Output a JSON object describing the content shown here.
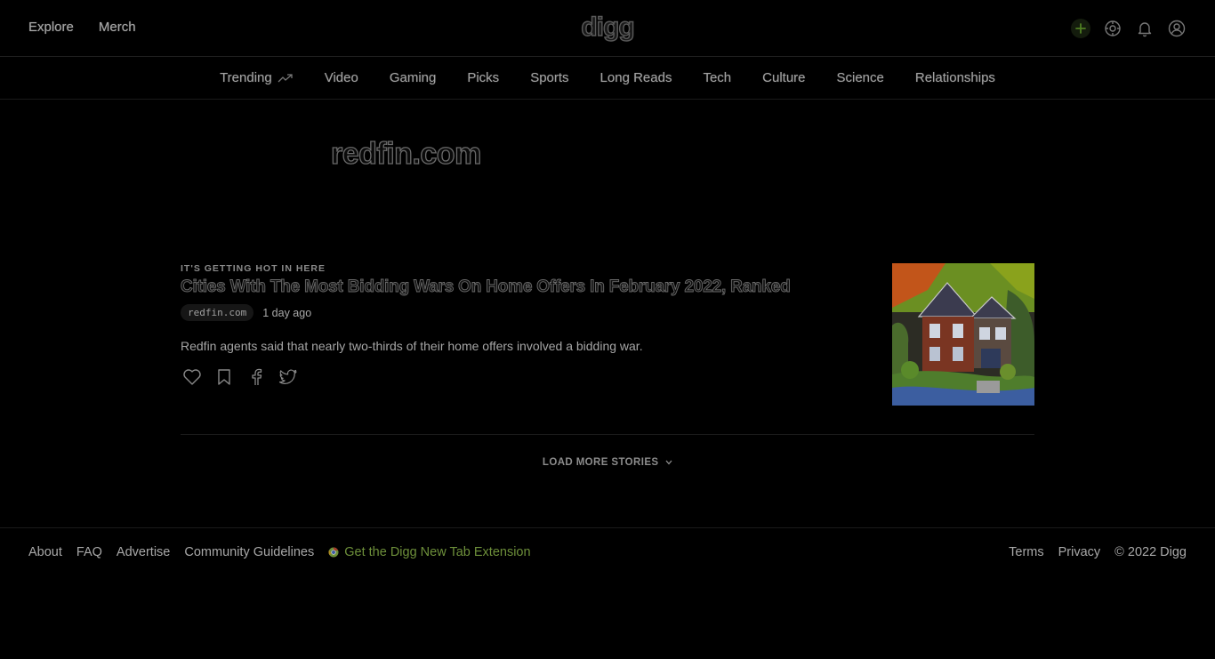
{
  "header": {
    "left_links": [
      "Explore",
      "Merch"
    ],
    "logo": "digg",
    "icons": [
      "plus-icon",
      "settings-icon",
      "bell-icon",
      "user-icon"
    ]
  },
  "nav": {
    "items": [
      "Trending",
      "Video",
      "Gaming",
      "Picks",
      "Sports",
      "Long Reads",
      "Tech",
      "Culture",
      "Science",
      "Relationships"
    ]
  },
  "page": {
    "title": "redfin.com"
  },
  "story": {
    "kicker": "IT'S GETTING HOT IN HERE",
    "title": "Cities With The Most Bidding Wars On Home Offers In February 2022, Ranked",
    "domain": "redfin.com",
    "time": "1 day ago",
    "description": "Redfin agents said that nearly two-thirds of their home offers involved a bidding war."
  },
  "load_more": "LOAD MORE STORIES",
  "footer": {
    "left_links": [
      "About",
      "FAQ",
      "Advertise",
      "Community Guidelines"
    ],
    "extension": "Get the Digg New Tab Extension",
    "right_links": [
      "Terms",
      "Privacy"
    ],
    "copyright": "© 2022 Digg"
  },
  "colors": {
    "background": "#000000",
    "accent_green": "#6d8f3a"
  }
}
